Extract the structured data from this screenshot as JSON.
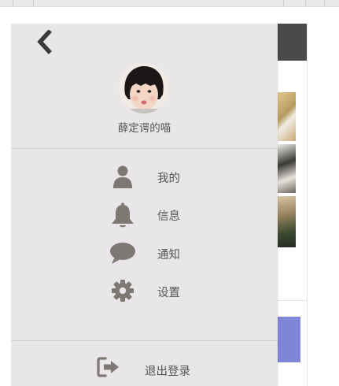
{
  "drawer": {
    "username": "薛定谔的喵",
    "menu_items": [
      {
        "label": "我的",
        "icon": "user-icon"
      },
      {
        "label": "信息",
        "icon": "bell-icon"
      },
      {
        "label": "通知",
        "icon": "comment-icon"
      },
      {
        "label": "设置",
        "icon": "gear-icon"
      }
    ],
    "logout_label": "退出登录",
    "icon_color": "#7d7874",
    "background_color": "#e8e6e8"
  },
  "page": {
    "header_color": "#4a4a4a",
    "button_color": "#7f86d8"
  }
}
